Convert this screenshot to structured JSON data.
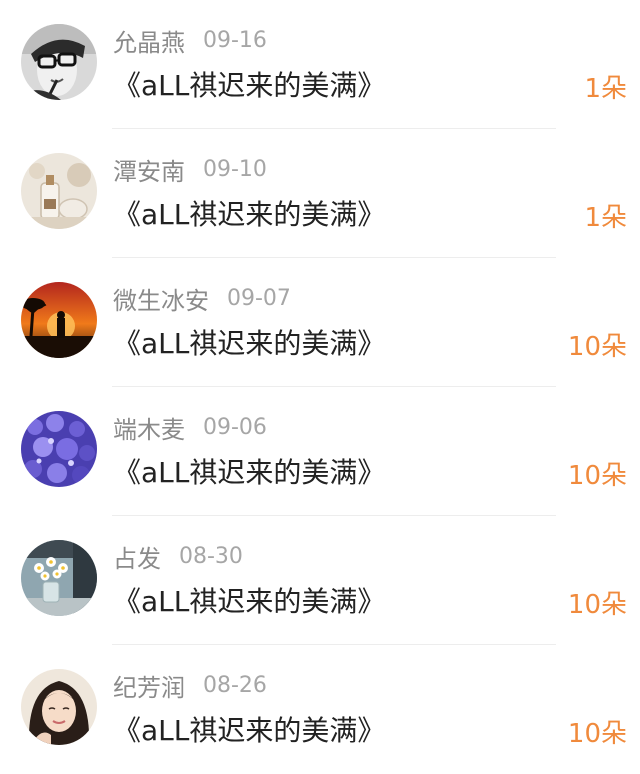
{
  "accent_color": "#f08a3c",
  "entries": [
    {
      "user": "允晶燕",
      "date": "09-16",
      "book": "《aLL祺迟来的美满》",
      "count": "1朵",
      "avatar": "avatar-woman-glasses-bw"
    },
    {
      "user": "潭安南",
      "date": "09-10",
      "book": "《aLL祺迟来的美满》",
      "count": "1朵",
      "avatar": "avatar-glass-bottle"
    },
    {
      "user": "微生冰安",
      "date": "09-07",
      "book": "《aLL祺迟来的美满》",
      "count": "10朵",
      "avatar": "avatar-sunset-silhouette"
    },
    {
      "user": "端木麦",
      "date": "09-06",
      "book": "《aLL祺迟来的美满》",
      "count": "10朵",
      "avatar": "avatar-purple-flowers"
    },
    {
      "user": "占发",
      "date": "08-30",
      "book": "《aLL祺迟来的美满》",
      "count": "10朵",
      "avatar": "avatar-daisy-vase"
    },
    {
      "user": "纪芳润",
      "date": "08-26",
      "book": "《aLL祺迟来的美满》",
      "count": "10朵",
      "avatar": "avatar-girl-portrait"
    }
  ]
}
